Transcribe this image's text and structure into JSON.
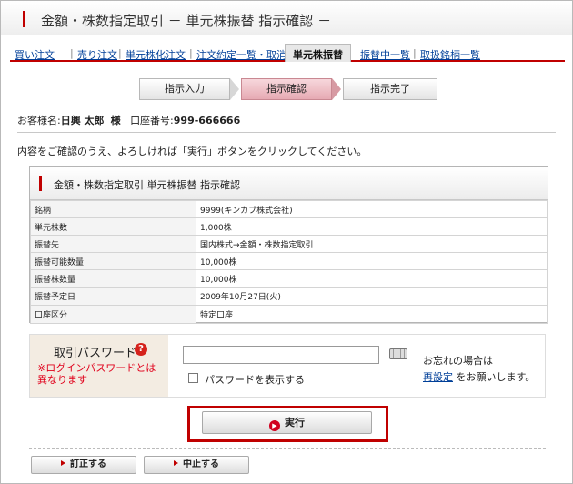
{
  "header": {
    "title": "金額・株数指定取引 － 単元株振替 指示確認 －"
  },
  "tabs": [
    {
      "label": "買い注文"
    },
    {
      "label": "売り注文"
    },
    {
      "label": "単元株化注文"
    },
    {
      "label": "注文約定一覧・取消"
    },
    {
      "label": "単元株振替"
    },
    {
      "label": "振替中一覧"
    },
    {
      "label": "取扱銘柄一覧"
    }
  ],
  "steps": [
    {
      "label": "指示入力"
    },
    {
      "label": "指示確認"
    },
    {
      "label": "指示完了"
    }
  ],
  "customer": {
    "prefix": "お客様名:",
    "name": "日興 太郎",
    "honorific": "様",
    "account_label": "口座番号:",
    "account_number": "999-666666"
  },
  "instruction": "内容をご確認のうえ、よろしければ「実行」ボタンをクリックしてください。",
  "detail": {
    "title": "金額・株数指定取引 単元株振替 指示確認",
    "rows": [
      {
        "key": "銘柄",
        "value": "9999(キンカブ株式会社)"
      },
      {
        "key": "単元株数",
        "value": "1,000株"
      },
      {
        "key": "振替先",
        "value": "国内株式→金額・株数指定取引"
      },
      {
        "key": "振替可能数量",
        "value": "10,000株"
      },
      {
        "key": "振替株数量",
        "value": "10,000株"
      },
      {
        "key": "振替予定日",
        "value": "2009年10月27日(火)"
      },
      {
        "key": "口座区分",
        "value": "特定口座"
      }
    ]
  },
  "password": {
    "title": "取引パスワード",
    "help": "?",
    "note": "※ログインパスワードとは異なります",
    "value": "",
    "show_password_label": "パスワードを表示する",
    "forgot_text": "お忘れの場合は",
    "reset_link": "再設定",
    "reset_suffix": "をお願いします。"
  },
  "buttons": {
    "execute": "実行",
    "correct": "訂正する",
    "cancel": "中止する"
  },
  "colors": {
    "accent": "#c00000",
    "link": "#003f98",
    "note": "#e0001b"
  }
}
